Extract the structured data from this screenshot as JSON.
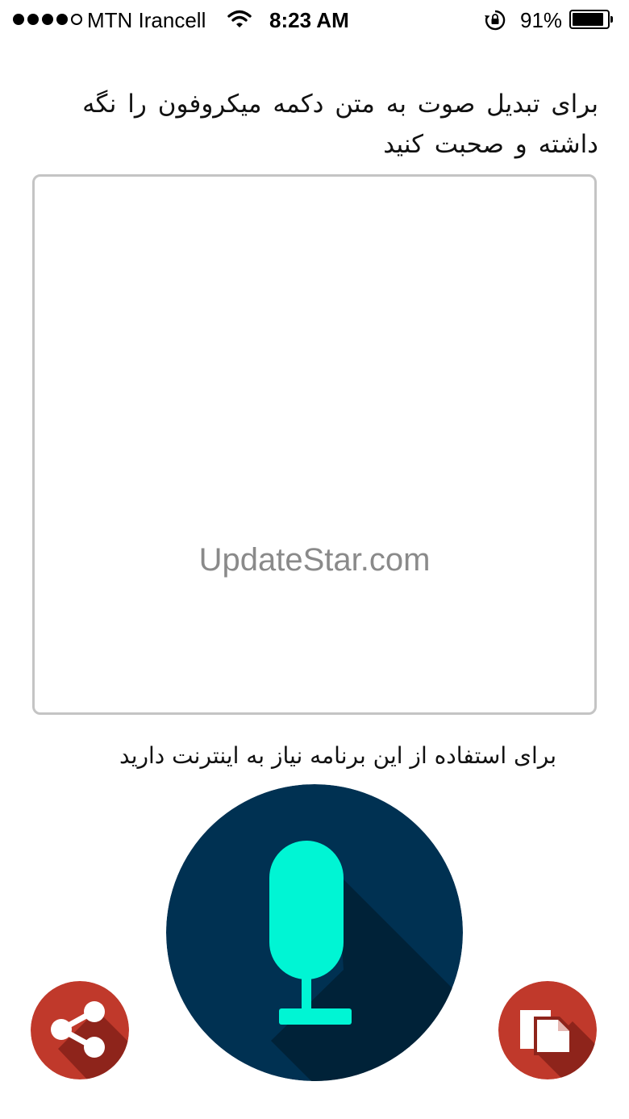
{
  "status_bar": {
    "carrier": "MTN Irancell",
    "time": "8:23 AM",
    "battery_percent": "91%",
    "battery_level": 0.91,
    "signal_bars_filled": 4,
    "signal_bars_total": 5,
    "icons": [
      "signal-dots",
      "wifi-icon",
      "rotation-lock-icon",
      "battery-icon"
    ]
  },
  "instruction": "برای تبدیل صوت به متن دکمه میکروفون را نگه داشته و صحبت کنید",
  "transcript_box": {
    "value": "",
    "watermark": "UpdateStar.com"
  },
  "internet_note": "برای استفاده از این برنامه نیاز به اینترنت دارید",
  "buttons": {
    "microphone": {
      "icon": "microphone-icon",
      "color": "#003152",
      "icon_color": "#00f5d4"
    },
    "share": {
      "icon": "share-icon",
      "color": "#c0392b"
    },
    "copy": {
      "icon": "copy-icon",
      "color": "#c0392b"
    }
  }
}
